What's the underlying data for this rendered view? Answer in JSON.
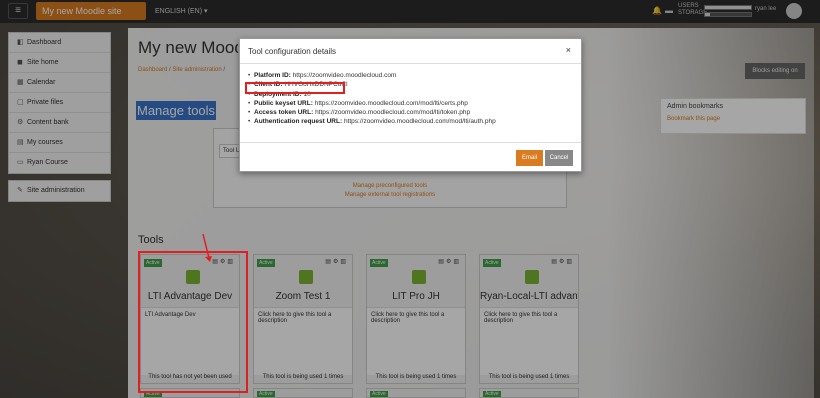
{
  "topbar": {
    "site_button": "My new Moodle site",
    "language": "ENGLISH (EN) ▾",
    "usage_label": "USERS\nSTORAGE",
    "users_usage": 0.99,
    "storage_usage": 0.1,
    "username": "ryan lee"
  },
  "nav": {
    "group1": [
      {
        "icon": "dashboard-icon",
        "label": "Dashboard"
      },
      {
        "icon": "home-icon",
        "label": "Site home"
      },
      {
        "icon": "calendar-icon",
        "label": "Calendar"
      },
      {
        "icon": "file-icon",
        "label": "Private files"
      },
      {
        "icon": "content-bank-icon",
        "label": "Content bank"
      },
      {
        "icon": "courses-icon",
        "label": "My courses"
      },
      {
        "icon": "course-icon",
        "label": "Ryan Course"
      }
    ],
    "group2": [
      {
        "icon": "wrench-icon",
        "label": "Site administration"
      }
    ]
  },
  "page": {
    "title": "My new Moodl",
    "breadcrumb": [
      "Dashboard",
      "Site administration"
    ],
    "blocks_editing_button": "Blocks editing on",
    "manage_tools_heading": "Manage tools",
    "tool_url_placeholder": "Tool UR",
    "manage_preconfigured": "Manage preconfigured tools",
    "manage_external": "Manage external tool registrations",
    "tools_heading": "Tools"
  },
  "admin_block": {
    "title": "Admin bookmarks",
    "link": "Bookmark this page"
  },
  "tools": [
    {
      "status": "Active",
      "name": "LTI Advantage Dev",
      "description": "LTI Advantage Dev",
      "usage": "This tool has not yet been used"
    },
    {
      "status": "Active",
      "name": "Zoom Test 1",
      "description": "Click here to give this tool a description",
      "usage": "This tool is being used 1 times"
    },
    {
      "status": "Active",
      "name": "LIT Pro JH",
      "description": "Click here to give this tool a description",
      "usage": "This tool is being used 1 times"
    },
    {
      "status": "Active",
      "name": "Ryan-Local-LTI advanta",
      "description": "Click here to give this tool a description",
      "usage": "This tool is being used 1 times"
    }
  ],
  "modal": {
    "title": "Tool configuration details",
    "close": "×",
    "rows": [
      {
        "label": "Platform ID:",
        "value": "https://zoomvideo.moodlecloud.com"
      },
      {
        "label": "Client ID:",
        "value": "HHVGoHxDDNPCuCl"
      },
      {
        "label": "Deployment ID:",
        "value": "10"
      },
      {
        "label": "Public keyset URL:",
        "value": "https://zoomvideo.moodlecloud.com/mod/lti/certs.php"
      },
      {
        "label": "Access token URL:",
        "value": "https://zoomvideo.moodlecloud.com/mod/lti/token.php"
      },
      {
        "label": "Authentication request URL:",
        "value": "https://zoomvideo.moodlecloud.com/mod/lti/auth.php"
      }
    ],
    "email_button": "Email",
    "cancel_button": "Cancel"
  },
  "colors": {
    "accent": "#d97b20",
    "active_badge": "#3fa047",
    "highlight": "#e02020"
  }
}
